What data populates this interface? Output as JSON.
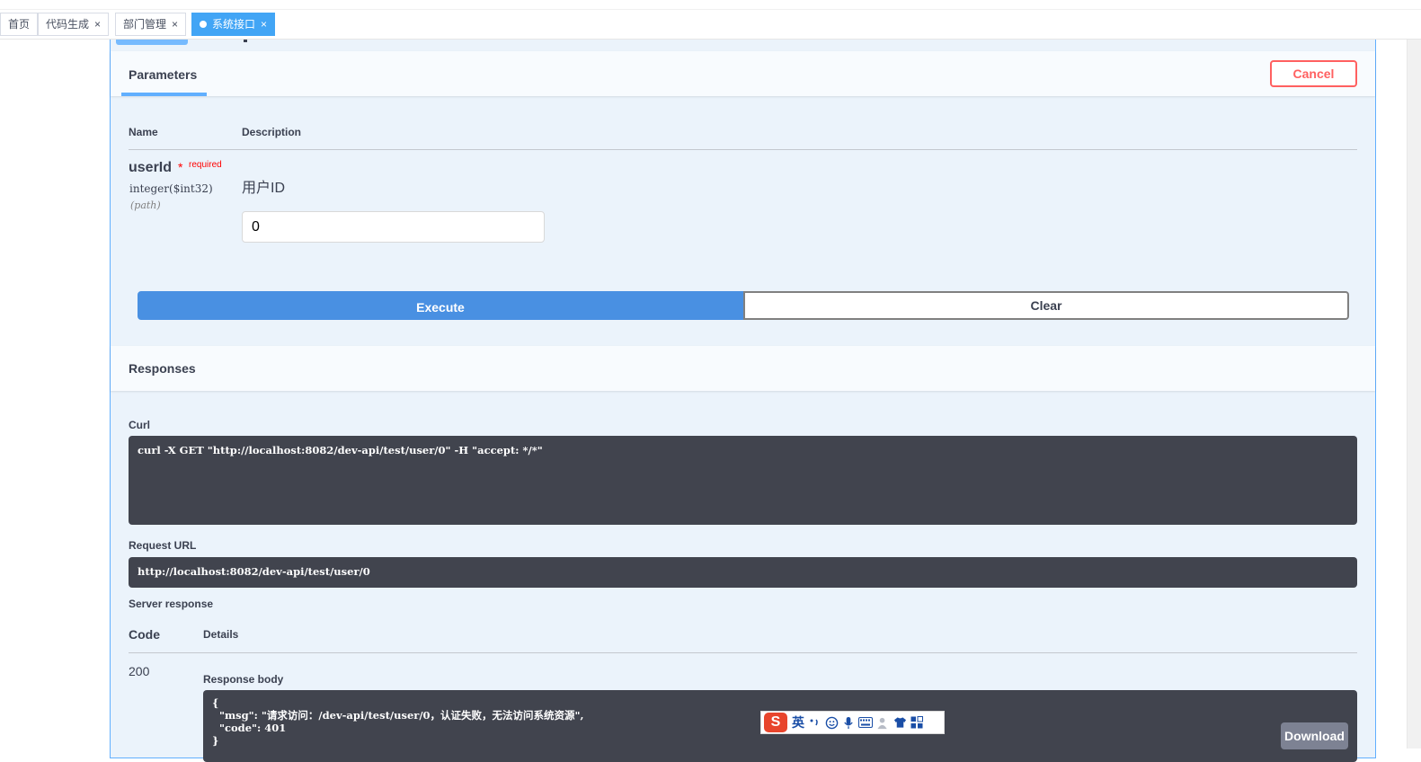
{
  "tabs": [
    {
      "label": "首页",
      "closable": false,
      "active": false
    },
    {
      "label": "代码生成",
      "closable": true,
      "active": false
    },
    {
      "label": "部门管理",
      "closable": true,
      "active": false
    },
    {
      "label": "系统接口",
      "closable": true,
      "active": true
    }
  ],
  "tab_close_glyph": "×",
  "parameters": {
    "title": "Parameters",
    "cancel_label": "Cancel",
    "col_name": "Name",
    "col_description": "Description",
    "items": [
      {
        "name": "userId",
        "required_star": "*",
        "required_label": "required",
        "type": "integer($int32)",
        "in": "(path)",
        "description": "用户ID",
        "value": "0"
      }
    ]
  },
  "actions": {
    "execute_label": "Execute",
    "clear_label": "Clear"
  },
  "responses": {
    "title": "Responses",
    "curl_label": "Curl",
    "curl_value": "curl -X GET \"http://localhost:8082/dev-api/test/user/0\" -H \"accept: */*\"",
    "request_url_label": "Request URL",
    "request_url_value": "http://localhost:8082/dev-api/test/user/0",
    "server_response_label": "Server response",
    "col_code": "Code",
    "col_details": "Details",
    "code": "200",
    "response_body_label": "Response body",
    "response_body": "{\n  \"msg\": \"请求访问：/dev-api/test/user/0，认证失败，无法访问系统资源\",\n  \"code\": 401\n}",
    "download_label": "Download"
  },
  "ime_toolbar": {
    "logo": "S",
    "lang": "英",
    "icons": [
      "punctuation-icon",
      "emoji-icon",
      "microphone-icon",
      "keyboard-icon",
      "user-icon",
      "skin-icon",
      "grid-icon"
    ]
  },
  "colors": {
    "accent_blue": "#61affe",
    "execute_blue": "#4990e2",
    "cancel_red": "#ff6060",
    "code_bg": "#41444e",
    "tab_active": "#42a5f5"
  }
}
